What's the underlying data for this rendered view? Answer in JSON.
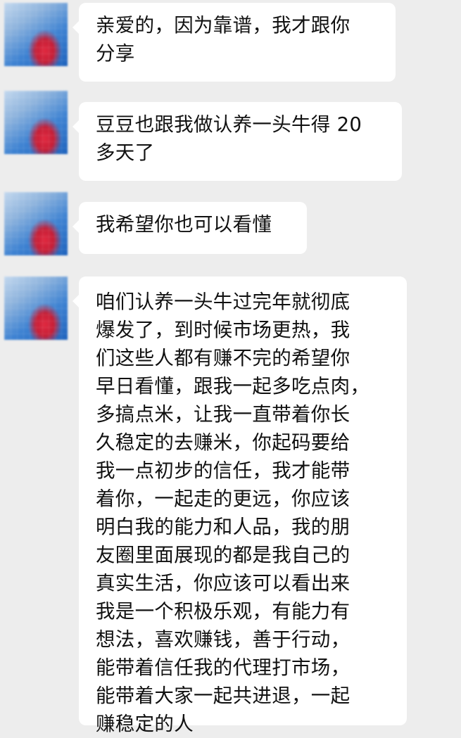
{
  "messages": [
    {
      "avatar_icon": "blurred-avatar",
      "text": "亲爱的，因为靠谱，我才跟你\n分享"
    },
    {
      "avatar_icon": "blurred-avatar",
      "text": "豆豆也跟我做认养一头牛得 20\n多天了"
    },
    {
      "avatar_icon": "blurred-avatar",
      "text": "我希望你也可以看懂"
    },
    {
      "avatar_icon": "blurred-avatar",
      "text": "咱们认养一头牛过完年就彻底\n爆发了，到时候市场更热，我\n们这些人都有赚不完的希望你\n早日看懂，跟我一起多吃点肉，\n多搞点米，让我一直带着你长\n久稳定的去赚米，你起码要给\n我一点初步的信任，我才能带\n着你，一起走的更远，你应该\n明白我的能力和人品，我的朋\n友圈里面展现的都是我自己的\n真实生活，你应该可以看出来\n我是一个积极乐观，有能力有\n想法，喜欢赚钱，善于行动，\n能带着信任我的代理打市场，\n能带着大家一起共进退，一起\n赚稳定的人"
    }
  ]
}
